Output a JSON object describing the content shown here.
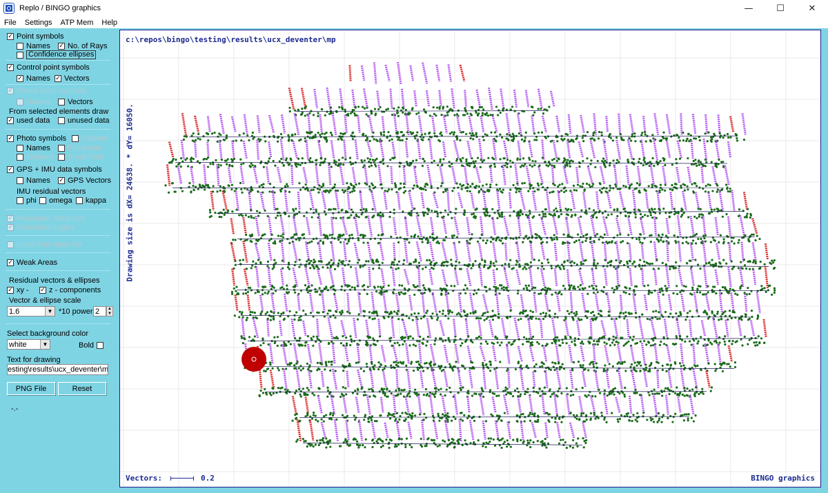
{
  "window": {
    "title": "Replo / BINGO graphics",
    "controls": {
      "minimize": "—",
      "maximize": "☐",
      "close": "✕"
    }
  },
  "menu": [
    "File",
    "Settings",
    "ATP Mem",
    "Help"
  ],
  "panel": {
    "point_symbols": {
      "label": "Point symbols",
      "checked": true
    },
    "names": {
      "label": "Names",
      "checked": false
    },
    "no_of_rays": {
      "label": "No. of Rays",
      "checked": true
    },
    "confidence_ellipses": {
      "label": "Confidence ellipses",
      "checked": false
    },
    "control_point_symbols": {
      "label": "Control point symbols",
      "checked": true
    },
    "cp_names": {
      "label": "Names",
      "checked": true
    },
    "cp_vectors": {
      "label": "Vectors",
      "checked": true
    },
    "check_point_symbols": {
      "label": "Check point symbols",
      "checked": true,
      "disabled": true
    },
    "chk_names": {
      "label": "Names",
      "checked": false,
      "disabled": true
    },
    "chk_vectors": {
      "label": "Vectors",
      "checked": false
    },
    "from_selected": "From selected elements draw",
    "used_data": {
      "label": "used data",
      "checked": true
    },
    "unused_data": {
      "label": "unused data",
      "checked": false
    },
    "photo_symbols": {
      "label": "Photo symbols",
      "checked": true
    },
    "colored": {
      "label": "Colored",
      "checked": false,
      "disabled": true
    },
    "photo_names": {
      "label": "Names",
      "checked": false
    },
    "footprints": {
      "label": "Footprints",
      "checked": false,
      "disabled": true
    },
    "colored2": {
      "label": "Colored",
      "checked": false,
      "disabled": true
    },
    "small_foot": {
      "label": "Small Foot",
      "checked": false,
      "disabled": true
    },
    "gps_imu": {
      "label": "GPS + IMU data symbols",
      "checked": true
    },
    "gps_names": {
      "label": "Names",
      "checked": false
    },
    "gps_vectors": {
      "label": "GPS Vectors",
      "checked": true
    },
    "imu_residual": "IMU residual vectors",
    "phi": {
      "label": "phi",
      "checked": false
    },
    "omega": {
      "label": "omega",
      "checked": false
    },
    "kappa": {
      "label": "kappa",
      "checked": false
    },
    "measured_distances": {
      "label": "Measured distances",
      "checked": true,
      "disabled": true
    },
    "measured_angles": {
      "label": "Measured angles",
      "checked": true,
      "disabled": true
    },
    "lines_from_linesfile": {
      "label": "Lines from lines-file",
      "checked": false,
      "disabled": true
    },
    "weak_areas": {
      "label": "Weak Areas",
      "checked": true
    },
    "residual_title": "Residual vectors & ellipses",
    "xy": {
      "label": "xy -",
      "checked": true
    },
    "z_components": {
      "label": "z - components",
      "checked": true
    },
    "vector_scale_label": "Vector & ellipse scale",
    "scale_value": "1.6",
    "power_label": "*10 power",
    "power_value": "2",
    "background_label": "Select background color",
    "background_value": "white",
    "bold": {
      "label": "Bold",
      "checked": false
    },
    "text_for_drawing_label": "Text for drawing",
    "text_for_drawing_value": "esting\\results\\ucx_deventer\\mp",
    "png_button": "PNG File",
    "reset_button": "Reset",
    "status": "-.-"
  },
  "drawing": {
    "path": "c:\\repos\\bingo\\testing\\results\\ucx_deventer\\mp",
    "size_text": "Drawing size is dX= 24638. * dY= 16050.",
    "vectors_label": "Vectors:",
    "vectors_value": "0.2",
    "brand": "BINGO graphics",
    "colors": {
      "purple": "#b04cf0",
      "green": "#1a6b1a",
      "red": "#d81818",
      "line": "#1a1a55"
    }
  }
}
